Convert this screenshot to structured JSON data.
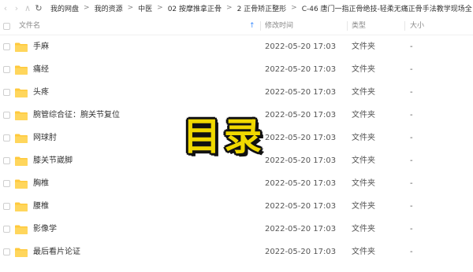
{
  "toolbar": {
    "breadcrumbs": [
      "我的网盘",
      "我的资源",
      "中医",
      "02 按摩推拿正骨",
      "2 正骨矫正整形",
      "C-46 唐门一指正骨绝技-轻柔无痛正骨手法教学现场全"
    ]
  },
  "header": {
    "name": "文件名",
    "modified": "修改时间",
    "type": "类型",
    "size": "大小"
  },
  "files": [
    {
      "name": "手麻",
      "modified": "2022-05-20 17:03",
      "type": "文件夹",
      "size": "-"
    },
    {
      "name": "痛经",
      "modified": "2022-05-20 17:03",
      "type": "文件夹",
      "size": "-"
    },
    {
      "name": "头疼",
      "modified": "2022-05-20 17:03",
      "type": "文件夹",
      "size": "-"
    },
    {
      "name": "腕管综合征：腕关节复位",
      "modified": "2022-05-20 17:03",
      "type": "文件夹",
      "size": "-"
    },
    {
      "name": "网球肘",
      "modified": "2022-05-20 17:03",
      "type": "文件夹",
      "size": "-"
    },
    {
      "name": "膝关节崴脚",
      "modified": "2022-05-20 17:03",
      "type": "文件夹",
      "size": "-"
    },
    {
      "name": "胸椎",
      "modified": "2022-05-20 17:03",
      "type": "文件夹",
      "size": "-"
    },
    {
      "name": "腰椎",
      "modified": "2022-05-20 17:03",
      "type": "文件夹",
      "size": "-"
    },
    {
      "name": "影像学",
      "modified": "2022-05-20 17:03",
      "type": "文件夹",
      "size": "-"
    },
    {
      "name": "最后看片论证",
      "modified": "2022-05-20 17:03",
      "type": "文件夹",
      "size": "-"
    }
  ],
  "overlay_title": "目录",
  "colors": {
    "folder": "#ffc93c",
    "overlay": "#f0d800",
    "sort_arrow": "#3b8cff"
  }
}
